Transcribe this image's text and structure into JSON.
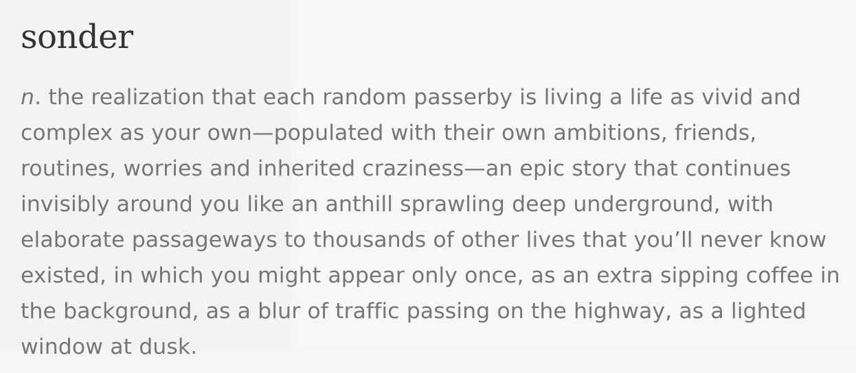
{
  "entry": {
    "word": "sonder",
    "part_of_speech": "n",
    "part_of_speech_suffix": ".",
    "definition": " the realization that each random passerby is living a life as vivid and complex as your own—populated with their own ambitions, friends, routines, worries and inherited craziness—an epic story that continues invisibly around you like an anthill sprawling deep underground, with elaborate passageways to thousands of other lives that you’ll never know existed, in which you might appear only once, as an extra sipping coffee in the background, as a blur of traffic passing on the highway, as a lighted window at dusk."
  }
}
